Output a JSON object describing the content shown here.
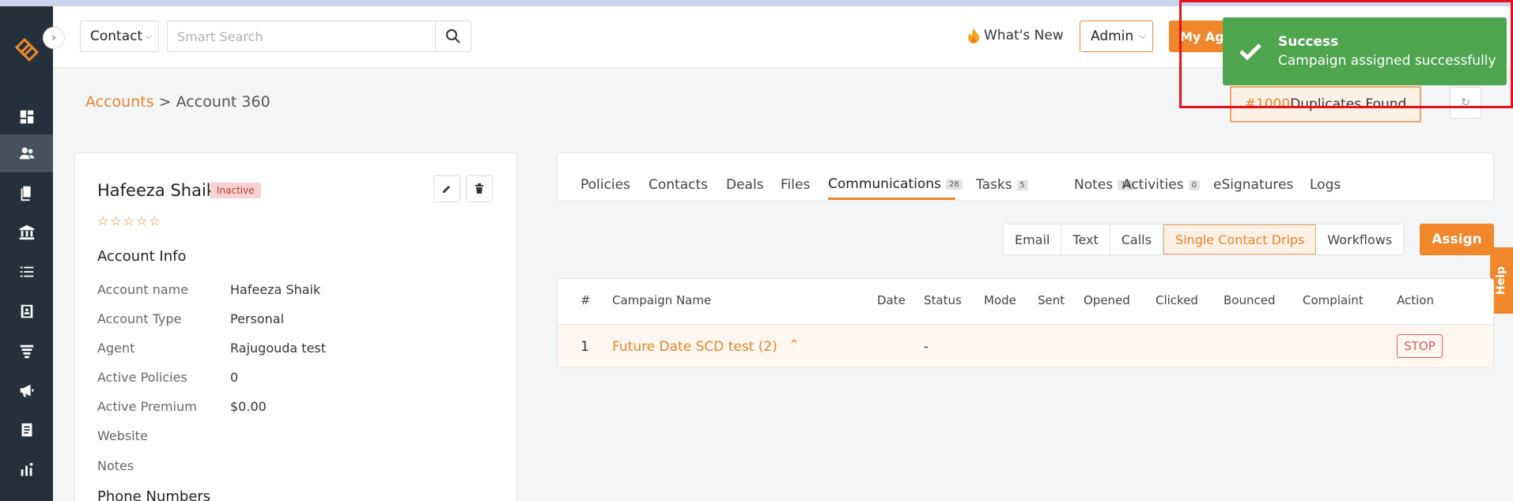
{
  "header": {
    "entity_select": "Contact",
    "search_placeholder": "Smart Search",
    "whats_new_label": "What's New",
    "role_select": "Admin",
    "my_agency_label": "My Agency"
  },
  "toast": {
    "title": "Success",
    "message": "Campaign assigned successfully"
  },
  "breadcrumb": {
    "parent": "Accounts",
    "separator": ">",
    "current": "Account 360"
  },
  "duplicates": {
    "count": "#1000",
    "label": "Duplicates Found"
  },
  "account": {
    "name": "Hafeeza Shaik",
    "status": "Inactive",
    "rating_stars": "☆☆☆☆☆",
    "section_title": "Account Info",
    "fields": [
      {
        "label": "Account name",
        "value": "Hafeeza Shaik"
      },
      {
        "label": "Account Type",
        "value": "Personal"
      },
      {
        "label": "Agent",
        "value": "Rajugouda test"
      },
      {
        "label": "Active Policies",
        "value": "0"
      },
      {
        "label": "Active Premium",
        "value": "$0.00"
      },
      {
        "label": "Website",
        "value": ""
      },
      {
        "label": "Notes",
        "value": ""
      }
    ],
    "phone_section_title": "Phone Numbers"
  },
  "tabs": [
    {
      "label": "Policies",
      "count": ""
    },
    {
      "label": "Contacts",
      "count": ""
    },
    {
      "label": "Deals",
      "count": ""
    },
    {
      "label": "Files",
      "count": ""
    },
    {
      "label": "Communications",
      "count": "28"
    },
    {
      "label": "Tasks",
      "count": "5"
    },
    {
      "label": "Notes",
      "count": "16"
    },
    {
      "label": "Activities",
      "count": "0"
    },
    {
      "label": "eSignatures",
      "count": ""
    },
    {
      "label": "Logs",
      "count": ""
    }
  ],
  "subtabs": [
    "Email",
    "Text",
    "Calls",
    "Single Contact Drips",
    "Workflows"
  ],
  "assign_label": "Assign",
  "help_label": "Help",
  "table": {
    "columns": [
      "#",
      "Campaign Name",
      "Date",
      "Status",
      "Mode",
      "Sent",
      "Opened",
      "Clicked",
      "Bounced",
      "Complaint",
      "Action"
    ],
    "rows": [
      {
        "index": "1",
        "campaign": "Future Date SCD test (2)",
        "date": "",
        "status": "-",
        "action": "STOP"
      }
    ]
  },
  "colors": {
    "accent": "#f0882b",
    "sidebar": "#24313c",
    "toast": "#4ea54e",
    "highlight_box": "#e6111a"
  }
}
